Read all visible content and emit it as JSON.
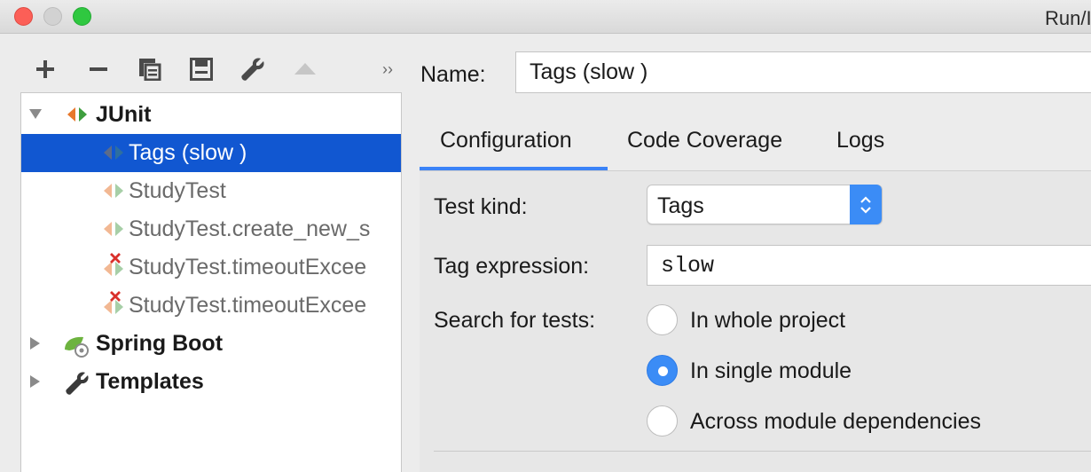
{
  "window": {
    "title": "Run/I"
  },
  "toolbar": {
    "buttons": [
      {
        "name": "add-icon"
      },
      {
        "name": "remove-icon"
      },
      {
        "name": "copy-icon"
      },
      {
        "name": "save-icon"
      },
      {
        "name": "wrench-icon"
      },
      {
        "name": "move-up-icon"
      },
      {
        "name": "more-icon"
      }
    ],
    "more_label": "››"
  },
  "tree": {
    "groups": [
      {
        "label": "JUnit",
        "expanded": true
      },
      {
        "label": "Spring Boot",
        "expanded": false
      },
      {
        "label": "Templates",
        "expanded": false
      }
    ],
    "items": [
      {
        "label": "Tags (slow )",
        "selected": true,
        "icon": "junit-icon",
        "error": false
      },
      {
        "label": "StudyTest",
        "selected": false,
        "icon": "junit-icon",
        "error": false
      },
      {
        "label": "StudyTest.create_new_s",
        "selected": false,
        "icon": "junit-icon",
        "error": false
      },
      {
        "label": "StudyTest.timeoutExcee",
        "selected": false,
        "icon": "junit-error-icon",
        "error": true
      },
      {
        "label": "StudyTest.timeoutExcee",
        "selected": false,
        "icon": "junit-error-icon",
        "error": true
      }
    ]
  },
  "form": {
    "name_label": "Name:",
    "name_value": "Tags (slow )",
    "tabs": [
      {
        "label": "Configuration",
        "active": true
      },
      {
        "label": "Code Coverage",
        "active": false
      },
      {
        "label": "Logs",
        "active": false
      }
    ],
    "test_kind_label": "Test kind:",
    "test_kind_value": "Tags",
    "tag_expression_label": "Tag expression:",
    "tag_expression_value": "slow",
    "search_label": "Search for tests:",
    "search_options": [
      {
        "label": "In whole project",
        "checked": false
      },
      {
        "label": "In single module",
        "checked": true
      },
      {
        "label": "Across module dependencies",
        "checked": false
      }
    ]
  },
  "colors": {
    "selection": "#1157d1",
    "accent": "#3b8cf6",
    "junit_orange": "#e8782c",
    "junit_green": "#3e9e3e",
    "error_red": "#d9302b",
    "spring_green": "#6db33f"
  }
}
